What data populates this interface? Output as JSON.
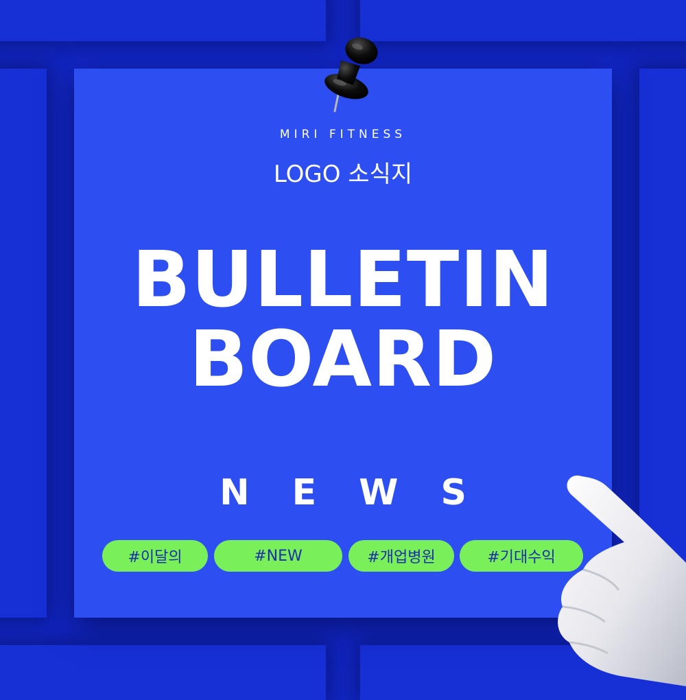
{
  "brand": "MIRI FITNESS",
  "subtitle": "LOGO 소식지",
  "headline": {
    "line1": "BULLETIN",
    "line2": "BOARD"
  },
  "section_label": "NEWS",
  "tags": [
    {
      "label": "#이달의"
    },
    {
      "label": "#NEW"
    },
    {
      "label": "#개업병원"
    },
    {
      "label": "#기대수익"
    }
  ],
  "decorations": {
    "pin": "push-pin-icon",
    "hand": "pointing-hand-icon"
  },
  "colors": {
    "background": "#1227c4",
    "board": "#2d4ef0",
    "tag_fill": "#79f05a",
    "tag_text": "#1c2ea8",
    "text": "#ffffff"
  }
}
